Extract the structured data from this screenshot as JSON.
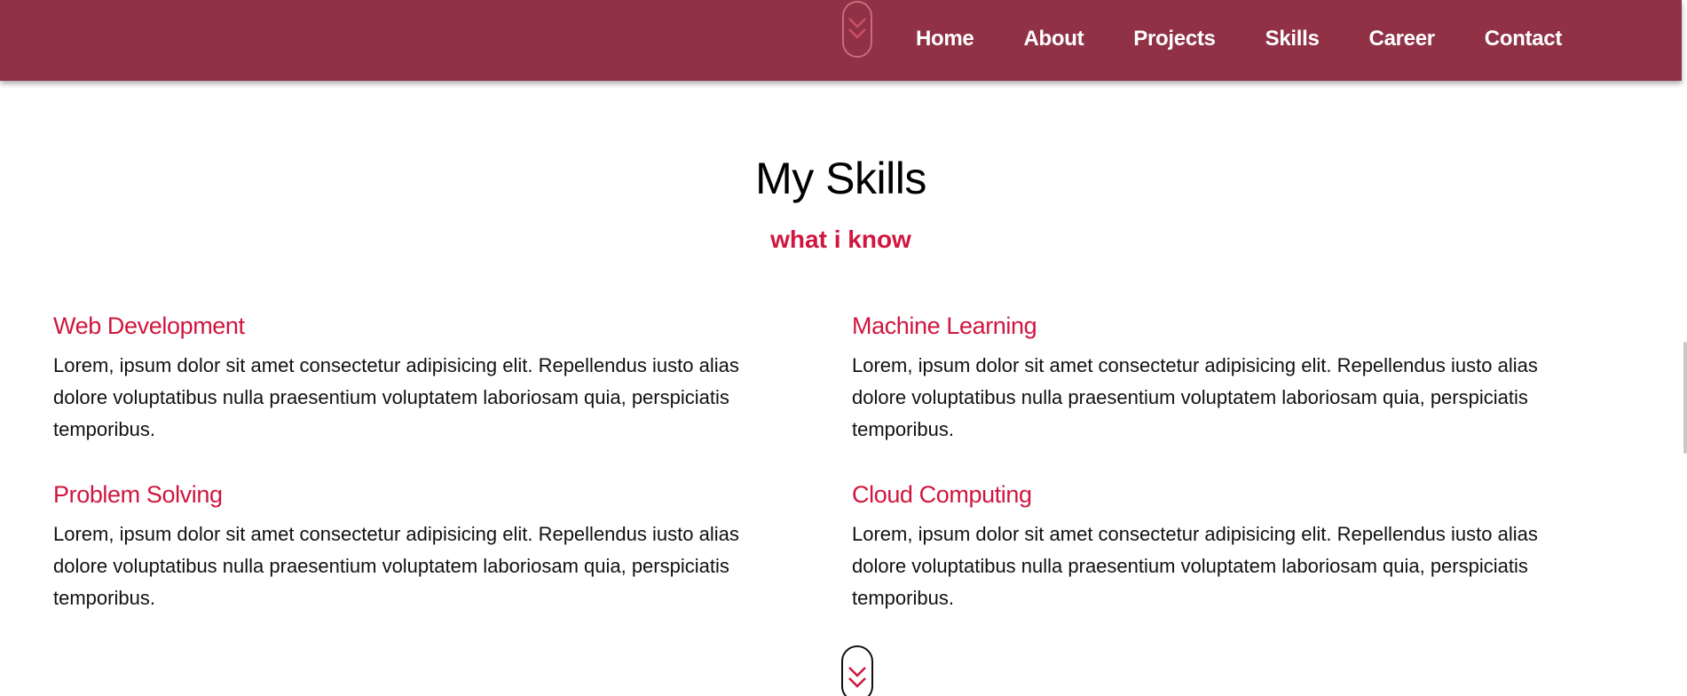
{
  "nav": {
    "links": [
      "Home",
      "About",
      "Projects",
      "Skills",
      "Career",
      "Contact"
    ],
    "scroll_icon": "double-chevron-down-icon"
  },
  "section": {
    "title": "My Skills",
    "subtitle": "what i know"
  },
  "skills": [
    {
      "title": "Web Development",
      "description": "Lorem, ipsum dolor sit amet consectetur adipisicing elit. Repellendus iusto alias dolore voluptatibus nulla praesentium voluptatem laboriosam quia, perspiciatis temporibus."
    },
    {
      "title": "Machine Learning",
      "description": "Lorem, ipsum dolor sit amet consectetur adipisicing elit. Repellendus iusto alias dolore voluptatibus nulla praesentium voluptatem laboriosam quia, perspiciatis temporibus."
    },
    {
      "title": "Problem Solving",
      "description": "Lorem, ipsum dolor sit amet consectetur adipisicing elit. Repellendus iusto alias dolore voluptatibus nulla praesentium voluptatem laboriosam quia, perspiciatis temporibus."
    },
    {
      "title": "Cloud Computing",
      "description": "Lorem, ipsum dolor sit amet consectetur adipisicing elit. Repellendus iusto alias dolore voluptatibus nulla praesentium voluptatem laboriosam quia, perspiciatis temporibus."
    }
  ],
  "colors": {
    "nav_background": "#903145",
    "accent": "#d0163e",
    "text": "#111111"
  }
}
